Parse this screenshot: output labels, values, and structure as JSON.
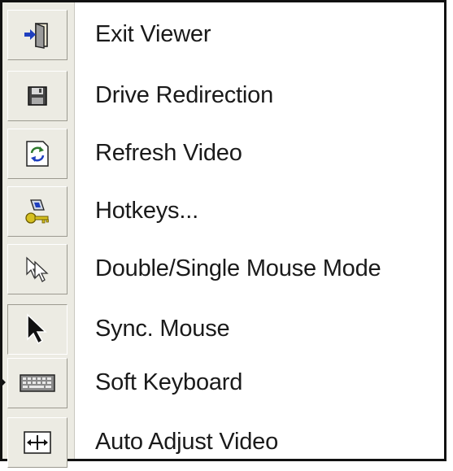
{
  "menu": {
    "items": [
      {
        "label": "Exit Viewer",
        "icon": "exit-door-icon"
      },
      {
        "label": "Drive Redirection",
        "icon": "floppy-disk-icon"
      },
      {
        "label": "Refresh Video",
        "icon": "refresh-icon"
      },
      {
        "label": "Hotkeys...",
        "icon": "hotkeys-key-icon"
      },
      {
        "label": "Double/Single Mouse Mode",
        "icon": "double-cursor-icon"
      },
      {
        "label": "Sync. Mouse",
        "icon": "mouse-pointer-icon"
      },
      {
        "label": "Soft Keyboard",
        "icon": "keyboard-icon"
      },
      {
        "label": "Auto Adjust Video",
        "icon": "auto-adjust-icon"
      }
    ]
  },
  "colors": {
    "rail": "#ecebe3",
    "border": "#111111",
    "text": "#1a1a1a",
    "accent_blue": "#1f3fbf",
    "accent_yellow": "#d6c020"
  }
}
